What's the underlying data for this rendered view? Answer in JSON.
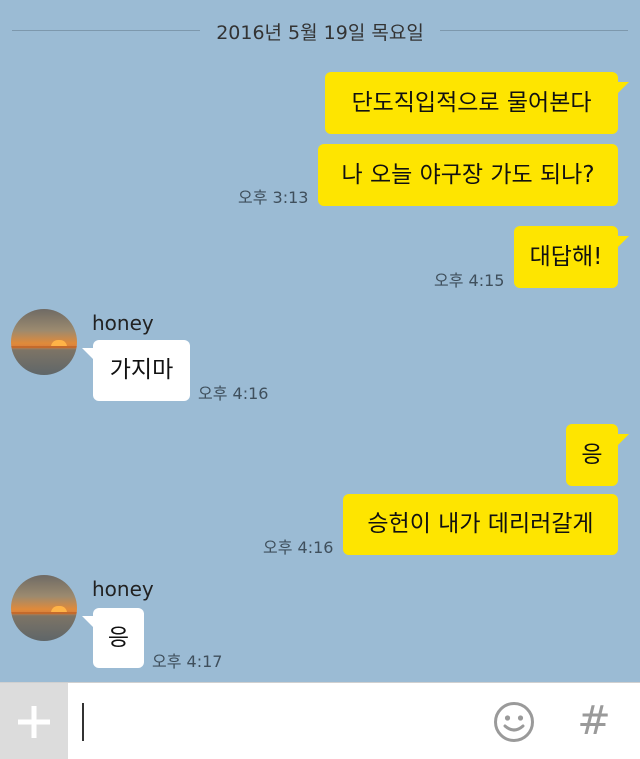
{
  "date_divider": "2016년 5월 19일 목요일",
  "messages": [
    {
      "sender": "me",
      "text": "단도직입적으로 물어본다"
    },
    {
      "sender": "me",
      "text": "나 오늘 야구장 가도 되나?",
      "time": "오후 3:13"
    },
    {
      "sender": "me",
      "text": "대답해!",
      "time": "오후 4:15"
    },
    {
      "sender": "friend",
      "name": "honey",
      "text": "가지마",
      "time": "오후 4:16"
    },
    {
      "sender": "me",
      "text": "응"
    },
    {
      "sender": "me",
      "text": "승헌이 내가 데리러갈게",
      "time": "오후 4:16"
    },
    {
      "sender": "friend",
      "name": "honey",
      "text": "응",
      "time": "오후 4:17"
    }
  ],
  "input_bar": {
    "plus_label": "+",
    "emoji_icon": "smiley-icon",
    "hash_label": "#"
  },
  "colors": {
    "background": "#9bbbd4",
    "my_bubble": "#fee500",
    "friend_bubble": "#ffffff"
  }
}
